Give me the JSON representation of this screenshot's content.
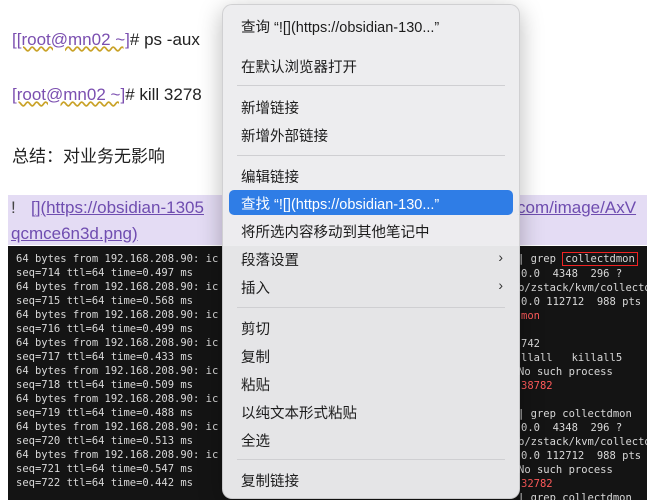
{
  "doc": {
    "line1_prompt": "[root@mn02 ~]",
    "line1_cmd": "# ps -aux",
    "line2_prompt": "[root@mn02 ~]",
    "line2_cmd": "# kill 3278",
    "summary": "总结：对业务无影响",
    "link_prefix": "!",
    "link_part1": "[](https://obsidian-1305",
    "link_part2": "com/image/AxV",
    "link_part3": "qcmce6n3d.png)"
  },
  "terminal": {
    "ping_lines": [
      "64 bytes from 192.168.208.90: ic",
      "seq=714 ttl=64 time=0.497 ms",
      "64 bytes from 192.168.208.90: ic",
      "seq=715 ttl=64 time=0.568 ms",
      "64 bytes from 192.168.208.90: ic",
      "seq=716 ttl=64 time=0.499 ms",
      "64 bytes from 192.168.208.90: ic",
      "seq=717 ttl=64 time=0.433 ms",
      "64 bytes from 192.168.208.90: ic",
      "seq=718 ttl=64 time=0.509 ms",
      "64 bytes from 192.168.208.90: ic",
      "seq=719 ttl=64 time=0.488 ms",
      "64 bytes from 192.168.208.90: ic",
      "seq=720 ttl=64 time=0.513 ms",
      "64 bytes from 192.168.208.90: ic",
      "seq=721 ttl=64 time=0.547 ms",
      "seq=722 ttl=64 time=0.442 ms"
    ],
    "right": {
      "r1_grep": "| grep",
      "r1_box": "collectdmon",
      "r2": "0.0  4348  296 ?",
      "r3": "b/zstack/kvm/collecto",
      "r4": "0.0 112712  988 pts",
      "r5": "mon",
      "r6": "742",
      "r7": "llall   killall5",
      "r8": "No such process",
      "r9": "38782",
      "r10": "| grep collectdmon",
      "r11": "0.0  4348  296 ?",
      "r12": "b/zstack/kvm/collecto",
      "r13": "0.0 112712  988 pts",
      "r14": "No such process",
      "r15": "32782",
      "r16": "| grep collectdmon"
    }
  },
  "menu": {
    "items": [
      {
        "label": "查询 “![](https://obsidian-130...”"
      },
      {
        "label": "在默认浏览器打开"
      },
      {
        "label": "新增链接"
      },
      {
        "label": "新增外部链接"
      },
      {
        "label": "编辑链接"
      },
      {
        "label": "查找 “![](https://obsidian-130...”"
      },
      {
        "label": "将所选内容移动到其他笔记中"
      },
      {
        "label": "段落设置"
      },
      {
        "label": "插入"
      },
      {
        "label": "剪切"
      },
      {
        "label": "复制"
      },
      {
        "label": "粘贴"
      },
      {
        "label": "以纯文本形式粘贴"
      },
      {
        "label": "全选"
      },
      {
        "label": "复制链接"
      }
    ],
    "chevron": "›"
  },
  "colors": {
    "highlight": "#2f7de6",
    "link": "#6f4db0",
    "prompt": "#7b4fb0",
    "terminal_bg": "#141414",
    "alert": "#ff5a5a"
  }
}
